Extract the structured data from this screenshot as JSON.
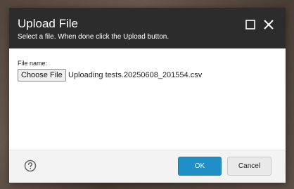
{
  "dialog": {
    "title": "Upload File",
    "subtitle": "Select a file. When done click the Upload button.",
    "header_icons": [
      "maximize-icon",
      "close-icon"
    ]
  },
  "body": {
    "file_label": "File name:",
    "choose_button_label": "Choose File",
    "status_text": "Uploading tests.20250608_201554.csv"
  },
  "footer": {
    "help_icon": "question-circle-icon",
    "ok_label": "OK",
    "cancel_label": "Cancel"
  },
  "colors": {
    "header_bg": "#2c2c2c",
    "primary_button": "#1f8fc7",
    "footer_bg": "#f3f3f3"
  }
}
